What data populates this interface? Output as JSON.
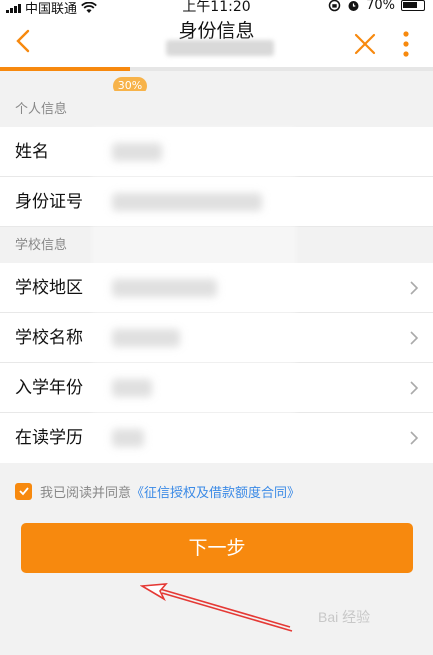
{
  "status_bar": {
    "carrier": "中国联通",
    "time": "上午11:20",
    "battery": "70%"
  },
  "nav": {
    "title": "身份信息"
  },
  "progress": {
    "percent": 0.3,
    "label": "30%"
  },
  "sections": [
    {
      "header": "个人信息",
      "rows": [
        {
          "label": "姓名"
        },
        {
          "label": "身份证号"
        }
      ]
    },
    {
      "header": "学校信息",
      "rows": [
        {
          "label": "学校地区"
        },
        {
          "label": "学校名称"
        },
        {
          "label": "入学年份"
        },
        {
          "label": "在读学历"
        }
      ]
    }
  ],
  "agreement": {
    "checked": true,
    "text": "我已阅读并同意",
    "link": "《征信授权及借款额度合同》"
  },
  "next_button": {
    "label": "下一步"
  },
  "watermark": "Bai 经验",
  "colors": {
    "accent": "#f7890e",
    "link": "#3b8ae6",
    "annotation": "#e53935"
  }
}
